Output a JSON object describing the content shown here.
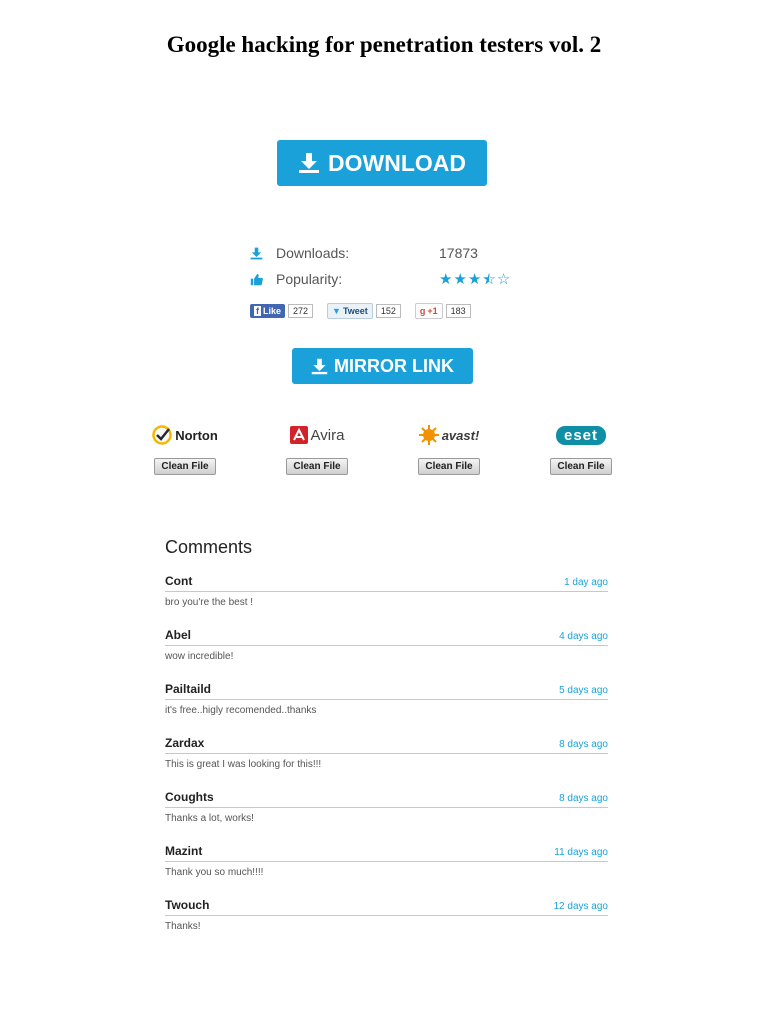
{
  "document": {
    "title": "Google hacking for penetration testers vol. 2"
  },
  "buttons": {
    "download_label": "DOWNLOAD",
    "mirror_label": "MIRROR LINK"
  },
  "stats": {
    "downloads_label": "Downloads:",
    "downloads_value": "17873",
    "popularity_label": "Popularity:",
    "popularity_rating": 3.5,
    "popularity_max": 5
  },
  "social": {
    "facebook": {
      "label": "Like",
      "count": "272"
    },
    "twitter": {
      "label": "Tweet",
      "count": "152"
    },
    "google": {
      "label": "+1",
      "count": "183"
    }
  },
  "antivirus": [
    {
      "name": "Norton",
      "badge": "Clean File",
      "color": "#f5b800"
    },
    {
      "name": "Avira",
      "badge": "Clean File",
      "color": "#d2232a"
    },
    {
      "name": "avast!",
      "badge": "Clean File",
      "color": "#f39200"
    },
    {
      "name": "eset",
      "badge": "Clean File",
      "color": "#0f8fa6"
    }
  ],
  "comments": {
    "title": "Comments",
    "items": [
      {
        "name": "Cont",
        "time": "1 day ago",
        "text": "bro you're the best !"
      },
      {
        "name": "Abel",
        "time": "4 days ago",
        "text": "wow incredible!"
      },
      {
        "name": "Pailtaild",
        "time": "5 days ago",
        "text": "it's free..higly recomended..thanks"
      },
      {
        "name": "Zardax",
        "time": "8 days ago",
        "text": "This is great I was looking for this!!!"
      },
      {
        "name": "Coughts",
        "time": "8 days ago",
        "text": "Thanks a lot, works!"
      },
      {
        "name": "Mazint",
        "time": "11 days ago",
        "text": "Thank you so much!!!!"
      },
      {
        "name": "Twouch",
        "time": "12 days ago",
        "text": "Thanks!"
      }
    ]
  },
  "colors": {
    "accent": "#1ba1d9"
  }
}
